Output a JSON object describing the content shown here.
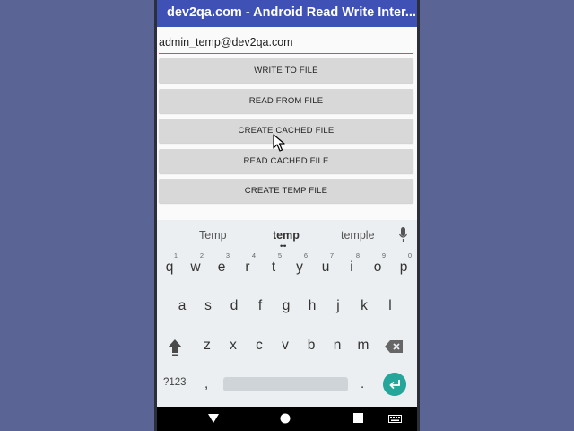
{
  "app": {
    "title": "dev2qa.com - Android Read Write Inter..."
  },
  "form": {
    "email_value": "admin_temp@dev2qa.com"
  },
  "buttons": [
    {
      "label": "WRITE TO FILE"
    },
    {
      "label": "READ FROM FILE"
    },
    {
      "label": "CREATE CACHED FILE"
    },
    {
      "label": "READ CACHED FILE"
    },
    {
      "label": "CREATE TEMP FILE"
    }
  ],
  "keyboard": {
    "suggestions": [
      "Temp",
      "temp",
      "temple"
    ],
    "row1": [
      {
        "key": "q",
        "hint": "1"
      },
      {
        "key": "w",
        "hint": "2"
      },
      {
        "key": "e",
        "hint": "3"
      },
      {
        "key": "r",
        "hint": "4"
      },
      {
        "key": "t",
        "hint": "5"
      },
      {
        "key": "y",
        "hint": "6"
      },
      {
        "key": "u",
        "hint": "7"
      },
      {
        "key": "i",
        "hint": "8"
      },
      {
        "key": "o",
        "hint": "9"
      },
      {
        "key": "p",
        "hint": "0"
      }
    ],
    "row2": [
      "a",
      "s",
      "d",
      "f",
      "g",
      "h",
      "j",
      "k",
      "l"
    ],
    "row3": [
      "z",
      "x",
      "c",
      "v",
      "b",
      "n",
      "m"
    ],
    "symbols_label": "?123",
    "comma": ",",
    "period": ".",
    "accent_color": "#26a69a"
  },
  "icons": {
    "mic": "mic-icon",
    "shift": "shift-icon",
    "backspace": "backspace-icon",
    "enter": "enter-icon",
    "nav_back": "back-triangle-icon",
    "nav_home": "home-circle-icon",
    "nav_recents": "recents-square-icon",
    "nav_keyboard": "keyboard-icon"
  },
  "colors": {
    "appbar": "#3f51b5",
    "underline": "#e0417a",
    "background": "#5b6595"
  }
}
